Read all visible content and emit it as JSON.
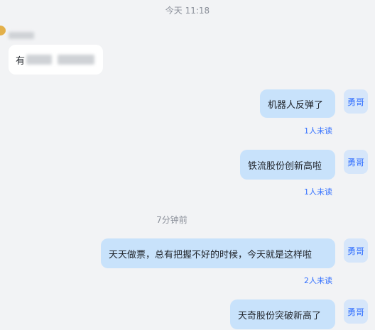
{
  "chat": {
    "timestamp_top": "今天 11:18",
    "timestamp_mid": "7分钟前",
    "incoming": {
      "text_prefix": "有"
    },
    "outgoing": [
      {
        "text": "机器人反弹了",
        "avatar": "勇哥",
        "status": "1人未读"
      },
      {
        "text": "铁流股份创新高啦",
        "avatar": "勇哥",
        "status": "1人未读"
      },
      {
        "text": "天天做票，总有把握不好的时候，今天就是这样啦",
        "avatar": "勇哥",
        "status": "2人未读"
      },
      {
        "text": "天奇股份突破新高了",
        "avatar": "勇哥"
      }
    ]
  }
}
